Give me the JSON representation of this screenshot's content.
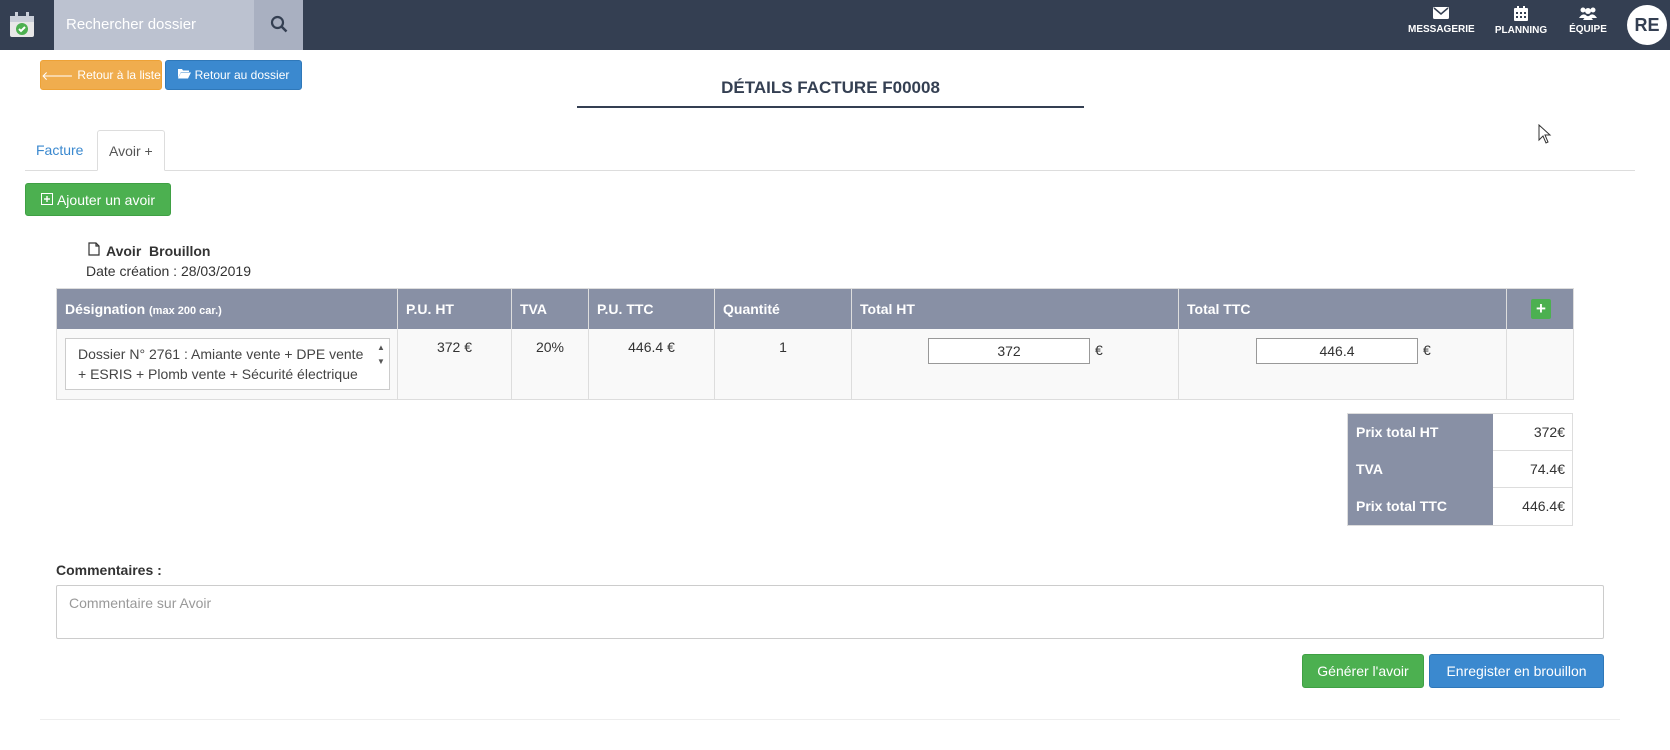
{
  "navbar": {
    "search_placeholder": "Rechercher dossier",
    "items": [
      {
        "label": "MESSAGERIE",
        "icon": "envelope-icon"
      },
      {
        "label": "PLANNING",
        "icon": "calendar-icon"
      },
      {
        "label": "ÉQUIPE",
        "icon": "users-icon"
      }
    ],
    "avatar": "RE"
  },
  "actions": {
    "back_list": "Retour à la liste",
    "back_dossier": "Retour au dossier"
  },
  "page": {
    "title": "DÉTAILS FACTURE F00008"
  },
  "tabs": [
    {
      "label": "Facture",
      "active": false
    },
    {
      "label": "Avoir +",
      "active": true
    }
  ],
  "add_avoir": "Ajouter un avoir",
  "avoir": {
    "title": "Avoir  Brouillon",
    "date": "Date création : 28/03/2019"
  },
  "table": {
    "headers": {
      "designation": "Désignation",
      "designation_hint": "(max 200 car.)",
      "pu_ht": "P.U. HT",
      "tva": "TVA",
      "pu_ttc": "P.U. TTC",
      "quantite": "Quantité",
      "total_ht": "Total HT",
      "total_ttc": "Total TTC"
    },
    "rows": [
      {
        "designation": "Dossier N° 2761 : Amiante vente + DPE vente + ESRIS + Plomb vente + Sécurité électrique Vente + Sécurité Gaz Vente",
        "pu_ht": "372 €",
        "tva": "20%",
        "pu_ttc": "446.4 €",
        "quantite": "1",
        "total_ht": "372",
        "total_ttc": "446.4",
        "currency": "€"
      }
    ]
  },
  "totals": [
    {
      "label": "Prix total HT",
      "value": "372€"
    },
    {
      "label": "TVA",
      "value": "74.4€"
    },
    {
      "label": "Prix total TTC",
      "value": "446.4€"
    }
  ],
  "comments": {
    "label": "Commentaires :",
    "placeholder": "Commentaire sur Avoir"
  },
  "footer_buttons": {
    "generate": "Générer l'avoir",
    "save_draft": "Enregister en brouillon"
  },
  "colors": {
    "navbar": "#343f52",
    "table_header": "#8890a5",
    "primary": "#3b89cf",
    "success": "#4cb050",
    "warning": "#f0ad4e"
  }
}
